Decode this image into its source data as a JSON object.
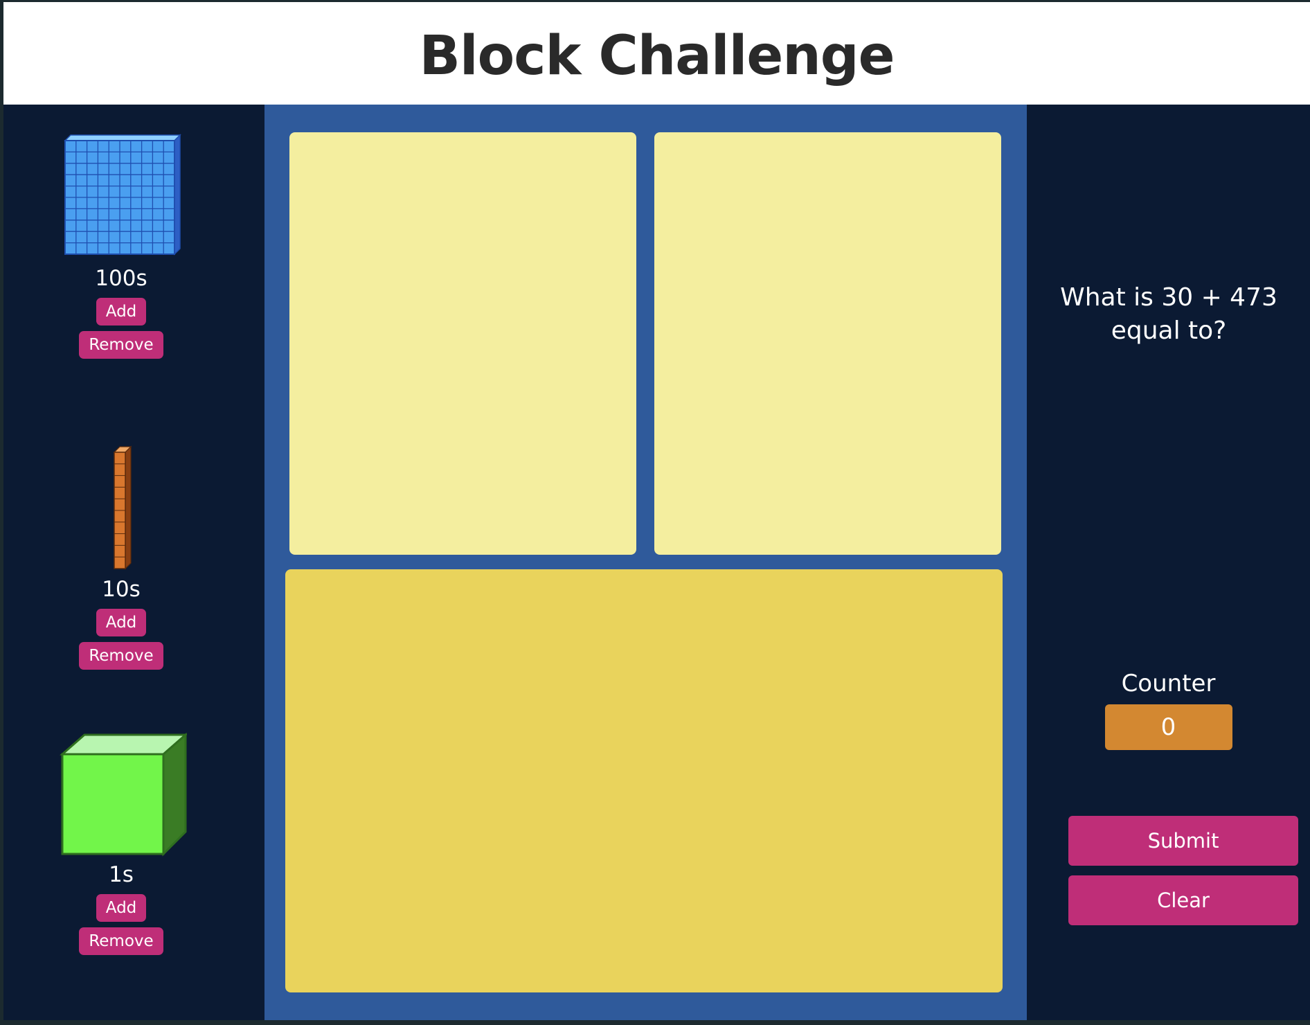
{
  "header": {
    "title": "Block Challenge"
  },
  "blocks": [
    {
      "label": "100s",
      "add_label": "Add",
      "remove_label": "Remove",
      "icon": "hundreds-flat-icon",
      "color": "#4a9ff0"
    },
    {
      "label": "10s",
      "add_label": "Add",
      "remove_label": "Remove",
      "icon": "tens-rod-icon",
      "color": "#d9772e"
    },
    {
      "label": "1s",
      "add_label": "Add",
      "remove_label": "Remove",
      "icon": "ones-cube-icon",
      "color": "#72f54a"
    }
  ],
  "question": {
    "text": "What is 30 + 473 equal to?"
  },
  "counter": {
    "label": "Counter",
    "value": "0"
  },
  "actions": {
    "submit_label": "Submit",
    "clear_label": "Clear"
  },
  "colors": {
    "background": "#0b1a33",
    "play_area": "#2f5a9b",
    "zone_light": "#f4ee9f",
    "zone_dark": "#e9d35c",
    "button": "#bf2e78",
    "counter": "#d38831"
  }
}
